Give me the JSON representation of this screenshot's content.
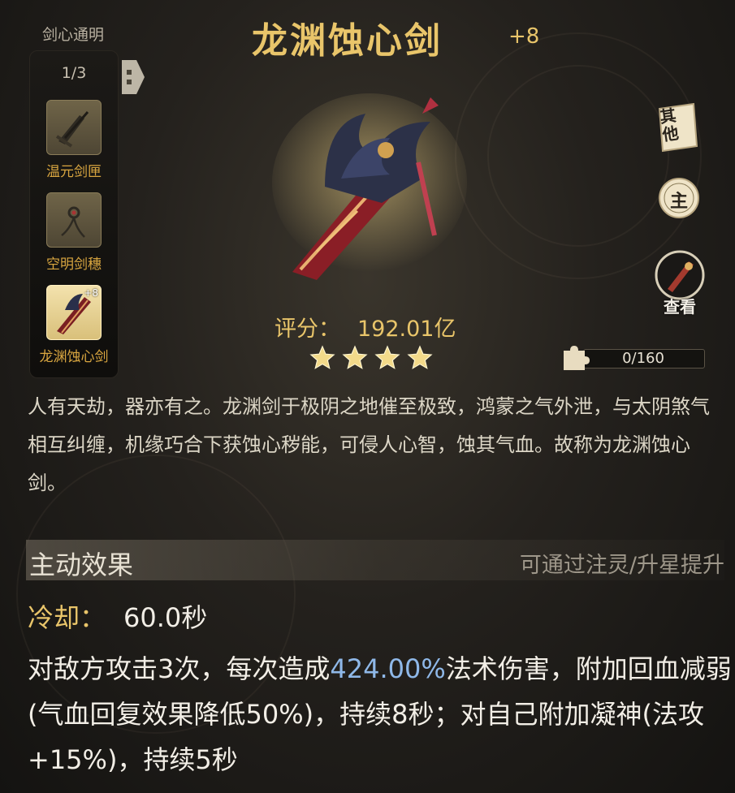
{
  "sidebar": {
    "title": "剑心通明",
    "count": "1/3",
    "items": [
      {
        "label": "温元剑匣",
        "icon": "sword-case-icon",
        "active": false
      },
      {
        "label": "空明剑穗",
        "icon": "sword-tassel-icon",
        "active": false
      },
      {
        "label": "龙渊蚀心剑",
        "icon": "dragon-sword-icon",
        "active": true,
        "badge": "+8"
      }
    ]
  },
  "item": {
    "name": "龙渊蚀心剑",
    "enhance": "+8",
    "score_label": "评分：",
    "score_value": "192.01亿",
    "stars": 4,
    "progress_text": "0/160",
    "progress": 0
  },
  "right_buttons": {
    "other": "其他",
    "main": "主",
    "view": "查看"
  },
  "description": "人有天劫，器亦有之。龙渊剑于极阴之地催至极致，鸿蒙之气外泄，与太阴煞气相互纠缠，机缘巧合下获蚀心秽能，可侵人心智，蚀其气血。故称为龙渊蚀心剑。",
  "active_effect": {
    "title": "主动效果",
    "hint": "可通过注灵/升星提升",
    "cooldown_label": "冷却：",
    "cooldown_value": "60.0秒",
    "text_1": "对敌方攻击3次，每次造成",
    "highlight": "424.00%",
    "text_2": "法术伤害，附加回血减弱(气血回复效果降低50%)，持续8秒；对自己附加凝神(法攻+15%)，持续5秒"
  },
  "colors": {
    "gold": "#e9c56a",
    "highlight_blue": "#8fb8e8",
    "label_orange": "#d9a640"
  }
}
